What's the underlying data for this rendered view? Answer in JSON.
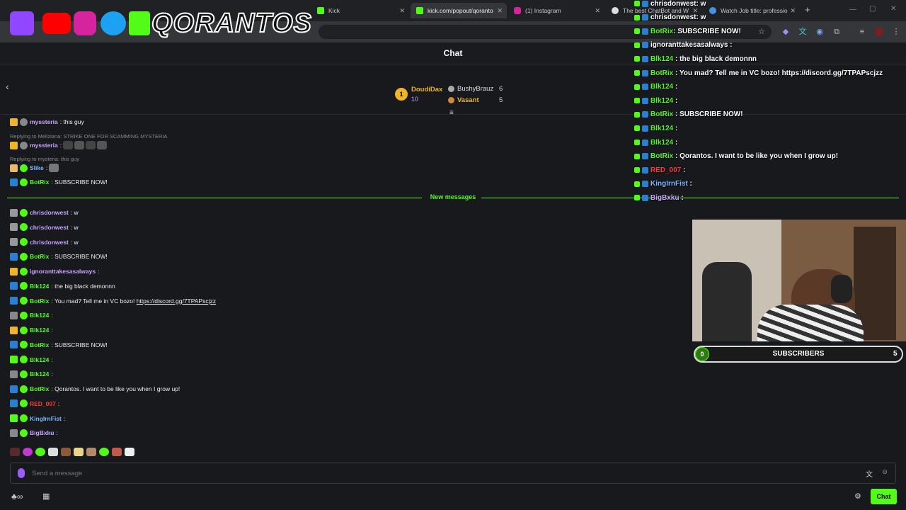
{
  "browser": {
    "tabs": [
      {
        "title": "Kick",
        "active": false
      },
      {
        "title": "kick.com/popout/qoranto",
        "active": true
      },
      {
        "title": "(1) Instagram",
        "active": false
      },
      {
        "title": "The best ChatBot and W",
        "active": false
      },
      {
        "title": "Watch Job title: professio",
        "active": false
      }
    ],
    "new_tab": "+"
  },
  "overlay": {
    "brand": "QORANTOS",
    "webcam_label": "",
    "sub_goal": {
      "current": "0",
      "label": "SUBSCRIBERS",
      "target": "5",
      "progress": 0.0
    },
    "chat": [
      {
        "user": "chrisdonwest",
        "text": ": w",
        "color": "#ffffff"
      },
      {
        "user": "chrisdonwest",
        "text": ": w",
        "color": "#ffffff"
      },
      {
        "user": "BotRix",
        "text": ": SUBSCRIBE NOW!",
        "color": "#53fc18"
      },
      {
        "user": "ignoranttakesasalways",
        "text": " :",
        "color": "#ffffff"
      },
      {
        "user": "Blk124",
        "text": " : the big black demonnn",
        "color": "#53fc18"
      },
      {
        "user": "BotRix",
        "text": " : You mad? Tell me in VC bozo! https://discord.gg/7TPAPscjzz",
        "color": "#53fc18"
      },
      {
        "user": "Blk124",
        "text": " :",
        "color": "#53fc18"
      },
      {
        "user": "Blk124",
        "text": " :",
        "color": "#53fc18"
      },
      {
        "user": "BotRix",
        "text": " : SUBSCRIBE NOW!",
        "color": "#53fc18"
      },
      {
        "user": "Blk124",
        "text": " :",
        "color": "#53fc18"
      },
      {
        "user": "Blk124",
        "text": " :",
        "color": "#53fc18"
      },
      {
        "user": "BotRix",
        "text": " : Qorantos. I want to be like you when I grow up!",
        "color": "#53fc18"
      },
      {
        "user": "RED_007",
        "text": " :",
        "color": "#ff3b3b"
      },
      {
        "user": "KingIrnFist",
        "text": " :",
        "color": "#7ab8ff"
      },
      {
        "user": "BigBxku",
        "text": " :",
        "color": "#c9a2ff"
      }
    ]
  },
  "chat": {
    "title": "Chat",
    "leaderboard": {
      "rank": "1",
      "first": {
        "name": "DoudiDax",
        "count": "10"
      },
      "second": {
        "name": "BushyBrauz",
        "count": "6"
      },
      "third": {
        "name": "Vasant",
        "count": "5"
      }
    },
    "messages_before": [
      {
        "user": "myssteria",
        "text": ": this guy",
        "color": "#c9a2ff",
        "reply": ""
      },
      {
        "user": "myssteria",
        "text": ":",
        "color": "#c9a2ff",
        "reply": "Replying to Meliziana: STRIKE ONE FOR SCAMMING MYSTERIA"
      },
      {
        "user": "Slike",
        "text": ":",
        "color": "#7ab8ff",
        "reply": "Replying to mysteria: this guy"
      },
      {
        "user": "BotRix",
        "text": ": SUBSCRIBE NOW!",
        "color": "#53fc18",
        "reply": ""
      }
    ],
    "new_messages_label": "New messages",
    "messages": [
      {
        "user": "chrisdonwest",
        "text": ": w",
        "color": "#c9a2ff"
      },
      {
        "user": "chrisdonwest",
        "text": ": w",
        "color": "#c9a2ff"
      },
      {
        "user": "chrisdonwest",
        "text": ": w",
        "color": "#c9a2ff"
      },
      {
        "user": "BotRix",
        "text": ": SUBSCRIBE NOW!",
        "color": "#53fc18"
      },
      {
        "user": "ignoranttakesasalways",
        "text": ":",
        "color": "#c9a2ff"
      },
      {
        "user": "Blk124",
        "text": ": the big black demonnn",
        "color": "#53fc18"
      },
      {
        "user": "BotRix",
        "text": ": You mad? Tell me in VC bozo! ",
        "color": "#53fc18",
        "link": "https://discord.gg/7TPAPscjzz"
      },
      {
        "user": "Blk124",
        "text": ":",
        "color": "#53fc18"
      },
      {
        "user": "Blk124",
        "text": ":",
        "color": "#53fc18"
      },
      {
        "user": "BotRix",
        "text": ": SUBSCRIBE NOW!",
        "color": "#53fc18"
      },
      {
        "user": "Blk124",
        "text": ":",
        "color": "#53fc18"
      },
      {
        "user": "Blk124",
        "text": ":",
        "color": "#53fc18"
      },
      {
        "user": "BotRix",
        "text": ": Qorantos. I want to be like you when I grow up!",
        "color": "#53fc18"
      },
      {
        "user": "RED_007",
        "text": ":",
        "color": "#ff3b3b"
      },
      {
        "user": "KingIrnFist",
        "text": ":",
        "color": "#7ab8ff"
      },
      {
        "user": "BigBxku",
        "text": ":",
        "color": "#c9a2ff"
      }
    ],
    "input_placeholder": "Send a message",
    "send_label": "Chat"
  }
}
